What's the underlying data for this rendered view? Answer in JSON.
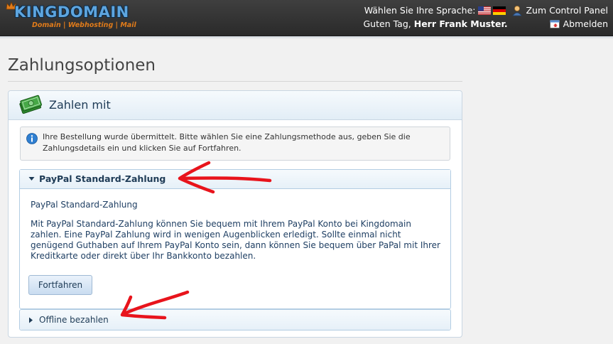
{
  "header": {
    "logo_title": "KINGDOMAIN",
    "logo_subtitle": "Domain | Webhosting | Mail",
    "language_label": "Wählen Sie Ihre Sprache:",
    "language_flags": [
      "us-flag-icon",
      "de-flag-icon"
    ],
    "control_panel_link": "Zum Control Panel",
    "greeting_prefix": "Guten Tag,",
    "greeting_name": "Herr Frank Muster.",
    "logout_link": "Abmelden"
  },
  "page": {
    "title": "Zahlungsoptionen"
  },
  "panel": {
    "title": "Zahlen mit",
    "icon": "money-icon",
    "info_text": "Ihre Bestellung wurde übermittelt. Bitte wählen Sie eine Zahlungsmethode aus, geben Sie die Zahlungsdetails ein und klicken Sie auf Fortfahren.",
    "options": [
      {
        "title": "PayPal Standard-Zahlung",
        "expanded": true,
        "heading": "PayPal Standard-Zahlung",
        "description": "Mit PayPal Standard-Zahlung können Sie bequem mit Ihrem PayPal Konto bei Kingdomain zahlen. Eine PayPal Zahlung wird in wenigen Augenblicken erledigt. Sollte einmal nicht genügend Guthaben auf Ihrem PayPal Konto sein, dann können Sie bequem über PaPal mit Ihrer Kreditkarte oder direkt über Ihr Bankkonto bezahlen.",
        "button": "Fortfahren"
      },
      {
        "title": "Offline bezahlen",
        "expanded": false
      }
    ]
  },
  "colors": {
    "header_bg": "#333333",
    "accent_blue": "#1e3b56",
    "annotation_red": "#e8141c"
  }
}
